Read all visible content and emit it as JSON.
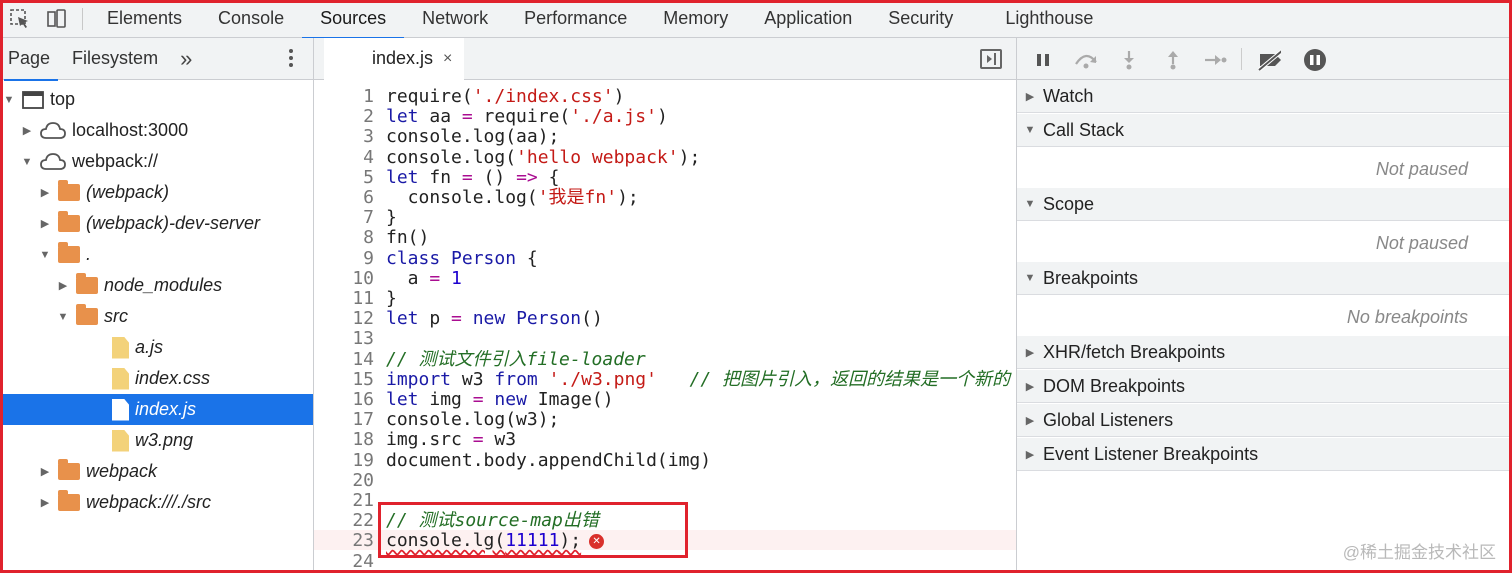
{
  "devtools_tabs": [
    "Elements",
    "Console",
    "Sources",
    "Network",
    "Performance",
    "Memory",
    "Application",
    "Security",
    "Lighthouse"
  ],
  "active_tab": "Sources",
  "navigator": {
    "tabs": [
      "Page",
      "Filesystem"
    ],
    "more": "»",
    "tree": [
      {
        "label": "top",
        "depth": 0,
        "icon": "frame",
        "expanded": true
      },
      {
        "label": "localhost:3000",
        "depth": 1,
        "icon": "cloud",
        "expanded": false
      },
      {
        "label": "webpack://",
        "depth": 1,
        "icon": "cloud",
        "expanded": true
      },
      {
        "label": "(webpack)",
        "depth": 2,
        "icon": "folder",
        "expanded": false,
        "italic": true
      },
      {
        "label": "(webpack)-dev-server",
        "depth": 2,
        "icon": "folder",
        "expanded": false,
        "italic": true
      },
      {
        "label": ".",
        "depth": 2,
        "icon": "folder",
        "expanded": true,
        "italic": true
      },
      {
        "label": "node_modules",
        "depth": 3,
        "icon": "folder",
        "expanded": false,
        "italic": true
      },
      {
        "label": "src",
        "depth": 3,
        "icon": "folder",
        "expanded": true,
        "italic": true
      },
      {
        "label": "a.js",
        "depth": 4,
        "icon": "file",
        "italic": true
      },
      {
        "label": "index.css",
        "depth": 4,
        "icon": "file",
        "italic": true
      },
      {
        "label": "index.js",
        "depth": 4,
        "icon": "file",
        "italic": true,
        "selected": true
      },
      {
        "label": "w3.png",
        "depth": 4,
        "icon": "file",
        "italic": true
      },
      {
        "label": "webpack",
        "depth": 2,
        "icon": "folder",
        "expanded": false,
        "italic": true
      },
      {
        "label": "webpack:///./src",
        "depth": 2,
        "icon": "folder",
        "expanded": false,
        "italic": true
      }
    ]
  },
  "editor": {
    "file_tab": "index.js",
    "close_glyph": "×",
    "error_line": 23,
    "lines": [
      "require('./index.css')",
      "let aa = require('./a.js')",
      "console.log(aa);",
      "console.log('hello webpack');",
      "let fn = () => {",
      "  console.log('我是fn');",
      "}",
      "fn()",
      "class Person {",
      "  a = 1",
      "}",
      "let p = new Person()",
      "",
      "// 测试文件引入file-loader",
      "import w3 from './w3.png'   // 把图片引入，返回的结果是一个新的",
      "let img = new Image()",
      "console.log(w3);",
      "img.src = w3",
      "document.body.appendChild(img)",
      "",
      "",
      "// 测试source-map出错",
      "console.lg(11111);",
      ""
    ]
  },
  "debugger": {
    "sections": [
      {
        "label": "Watch",
        "expanded": false
      },
      {
        "label": "Call Stack",
        "expanded": true,
        "empty": "Not paused"
      },
      {
        "label": "Scope",
        "expanded": true,
        "empty": "Not paused"
      },
      {
        "label": "Breakpoints",
        "expanded": true,
        "empty": "No breakpoints"
      },
      {
        "label": "XHR/fetch Breakpoints",
        "expanded": false
      },
      {
        "label": "DOM Breakpoints",
        "expanded": false
      },
      {
        "label": "Global Listeners",
        "expanded": false
      },
      {
        "label": "Event Listener Breakpoints",
        "expanded": false
      }
    ]
  },
  "watermark": "@稀土掘金技术社区",
  "colors": {
    "accent": "#1a73e8",
    "annotation_red": "#e0222d",
    "folder": "#e8914b",
    "file": "#f3d27a"
  }
}
